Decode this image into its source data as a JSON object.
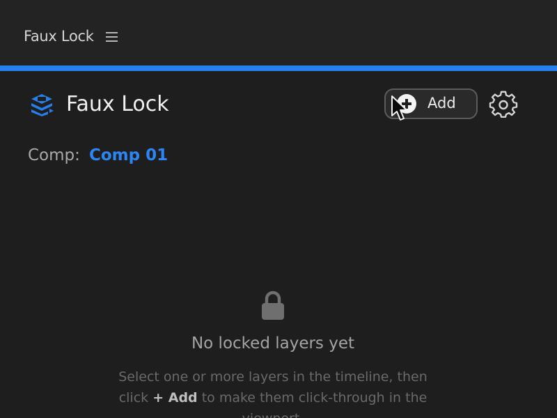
{
  "panel": {
    "tab_title": "Faux Lock",
    "menu_icon": "hamburger-menu-icon",
    "accent_color": "#2680eb"
  },
  "header": {
    "logo_icon": "layers-stack-icon",
    "title": "Faux Lock",
    "add_button": {
      "icon": "plus-circle-icon",
      "label": "Add"
    },
    "settings_icon": "gear-icon"
  },
  "comp": {
    "label": "Comp:",
    "name": "Comp 01",
    "name_color": "#2c86f1"
  },
  "empty_state": {
    "icon": "lock-icon",
    "heading": "No locked layers yet",
    "description_before": "Select one or more layers in the timeline, then click",
    "description_action": "+ Add",
    "description_after": "to make them click-through in the viewport."
  },
  "cursor": "arrow-cursor-icon"
}
